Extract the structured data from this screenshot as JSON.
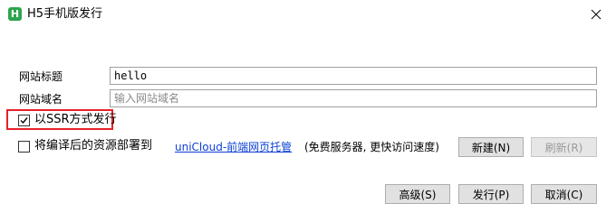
{
  "window": {
    "icon_letter": "H",
    "title": "H5手机版发行"
  },
  "form": {
    "site_title": {
      "label": "网站标题",
      "value": "hello"
    },
    "site_domain": {
      "label": "网站域名",
      "value": "",
      "placeholder": "输入网站域名"
    },
    "ssr": {
      "label": "以SSR方式发行",
      "checked": true
    },
    "deploy": {
      "label": "将编译后的资源部署到",
      "checked": false,
      "link_text": "uniCloud-前端网页托管",
      "note": "(免费服务器, 更快访问速度)"
    }
  },
  "buttons": {
    "create": "新建(N)",
    "refresh": "刷新(R)",
    "advanced": "高级(S)",
    "publish": "发行(P)",
    "cancel": "取消(C)"
  },
  "colors": {
    "highlight_border": "#e8202a",
    "link": "#0b3fd6",
    "app_icon": "#2ea44f"
  }
}
